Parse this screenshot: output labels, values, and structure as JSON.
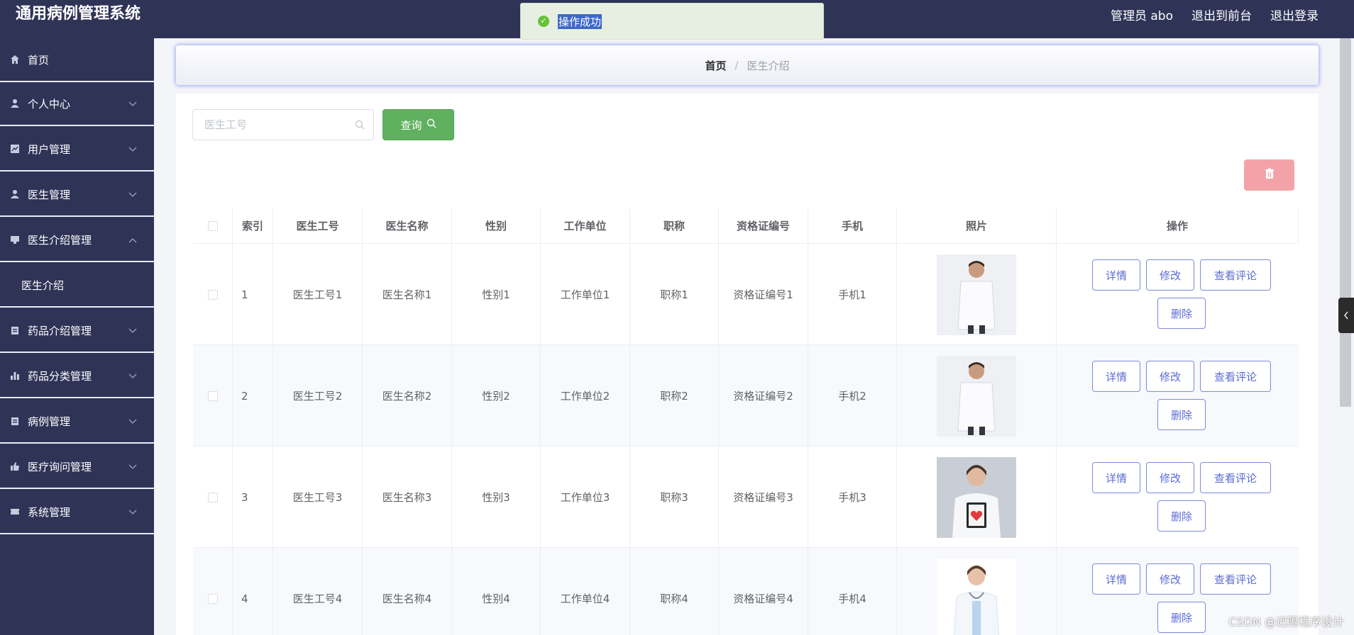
{
  "header": {
    "app_title": "通用病例管理系统",
    "admin_label": "管理员 abo",
    "back_to_front": "退出到前台",
    "logout": "退出登录"
  },
  "toast": {
    "message": "操作成功"
  },
  "sidebar": {
    "items": [
      {
        "label": "首页",
        "icon": "home-icon",
        "has_children": false
      },
      {
        "label": "个人中心",
        "icon": "user-icon",
        "has_children": true
      },
      {
        "label": "用户管理",
        "icon": "chart-icon",
        "has_children": true
      },
      {
        "label": "医生管理",
        "icon": "user-icon",
        "has_children": true
      },
      {
        "label": "医生介绍管理",
        "icon": "monitor-icon",
        "has_children": true,
        "expanded": true
      },
      {
        "label": "医生介绍",
        "submenu": true
      },
      {
        "label": "药品介绍管理",
        "icon": "clipboard-icon",
        "has_children": true
      },
      {
        "label": "药品分类管理",
        "icon": "bar-chart-icon",
        "has_children": true
      },
      {
        "label": "病例管理",
        "icon": "clipboard-icon",
        "has_children": true
      },
      {
        "label": "医疗询问管理",
        "icon": "thumb-icon",
        "has_children": true
      },
      {
        "label": "系统管理",
        "icon": "ticket-icon",
        "has_children": true
      }
    ]
  },
  "breadcrumb": {
    "home": "首页",
    "separator": "/",
    "current": "医生介绍"
  },
  "search": {
    "placeholder": "医生工号",
    "value": "",
    "query_label": "查询"
  },
  "table": {
    "columns": [
      "索引",
      "医生工号",
      "医生名称",
      "性别",
      "工作单位",
      "职称",
      "资格证编号",
      "手机",
      "照片",
      "操作"
    ],
    "rows": [
      {
        "index": "1",
        "doctor_id": "医生工号1",
        "name": "医生名称1",
        "gender": "性别1",
        "unit": "工作单位1",
        "title": "职称1",
        "cert": "资格证编号1",
        "phone": "手机1"
      },
      {
        "index": "2",
        "doctor_id": "医生工号2",
        "name": "医生名称2",
        "gender": "性别2",
        "unit": "工作单位2",
        "title": "职称2",
        "cert": "资格证编号2",
        "phone": "手机2"
      },
      {
        "index": "3",
        "doctor_id": "医生工号3",
        "name": "医生名称3",
        "gender": "性别3",
        "unit": "工作单位3",
        "title": "职称3",
        "cert": "资格证编号3",
        "phone": "手机3"
      },
      {
        "index": "4",
        "doctor_id": "医生工号4",
        "name": "医生名称4",
        "gender": "性别4",
        "unit": "工作单位4",
        "title": "职称4",
        "cert": "资格证编号4",
        "phone": "手机4"
      }
    ],
    "actions": {
      "detail": "详情",
      "edit": "修改",
      "comments": "查看评论",
      "delete": "删除"
    }
  },
  "watermark": "CSDN @迟限程序设计",
  "colors": {
    "sidebar_bg": "#2f3457",
    "primary": "#5b6bd4",
    "success": "#5fb15f",
    "danger_light": "#f3a3a8"
  }
}
